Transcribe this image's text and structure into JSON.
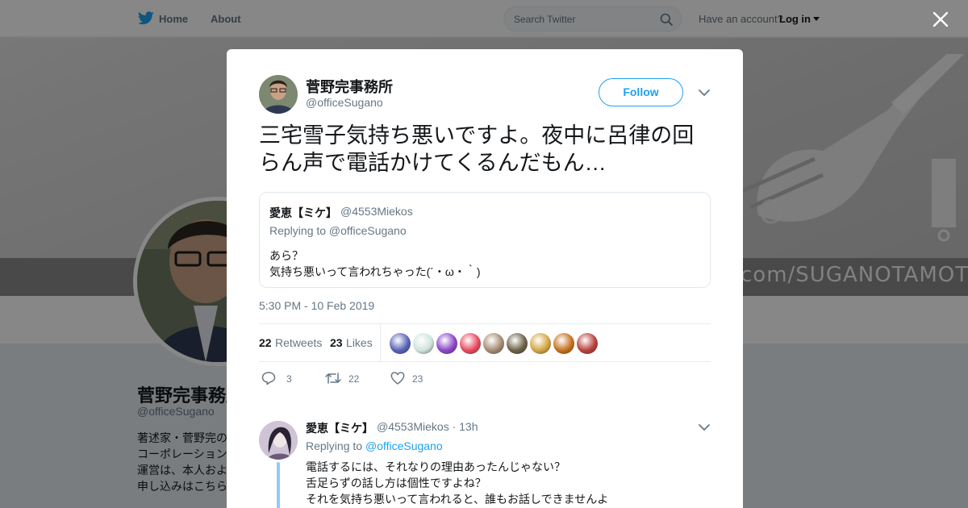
{
  "topbar": {
    "home_label": "Home",
    "about_label": "About",
    "search_placeholder": "Search Twitter",
    "account_prompt": "Have an account?",
    "login_label": "Log in"
  },
  "profile": {
    "banner_text": "com/SUGANOTAMOTSU",
    "name": "菅野完事務所",
    "handle": "@officeSugano",
    "bio_lines": [
      "著述家・菅野完の",
      "コーポレーション",
      "運営は、本人およ",
      "申し込みはこちら"
    ]
  },
  "tweet": {
    "author_name": "菅野完事務所",
    "author_handle": "@officeSugano",
    "follow_label": "Follow",
    "text": "三宅雪子気持ち悪いですよ。夜中に呂律の回らん声で電話かけてくるんだもん…",
    "quoted": {
      "name": "愛恵【ミケ】",
      "handle": "@4553Miekos",
      "replying_to": "Replying to @officeSugano",
      "line1": "あら？",
      "line2": "気持ち悪いって言われちゃった(´・ω・｀)"
    },
    "timestamp": "5:30 PM - 10 Feb 2019",
    "retweets_count": "22",
    "retweets_label": "Retweets",
    "likes_count": "23",
    "likes_label": "Likes",
    "likers": [
      {
        "color": "#5a63b8"
      },
      {
        "color": "#cfe3dd"
      },
      {
        "color": "#8b46c9"
      },
      {
        "color": "#e84a5f"
      },
      {
        "color": "#a58c72"
      },
      {
        "color": "#6d6248"
      },
      {
        "color": "#d4a642"
      },
      {
        "color": "#c7711e"
      },
      {
        "color": "#b8423c"
      }
    ],
    "actions": {
      "reply_count": "3",
      "retweet_count": "22",
      "like_count": "23"
    }
  },
  "reply": {
    "name": "愛恵【ミケ】",
    "handle_time": "@4553Miekos · 13h",
    "replying_prefix": "Replying to",
    "replying_handle": "@officeSugano",
    "line1": "電話するには、それなりの理由あったんじゃない？",
    "line2": "舌足らずの話し方は個性ですよね？",
    "line3": "それを気持ち悪いって言われると、誰もお話しできませんよ"
  },
  "colors": {
    "accent": "#1da1f2",
    "text": "#14171a",
    "muted": "#657786"
  }
}
